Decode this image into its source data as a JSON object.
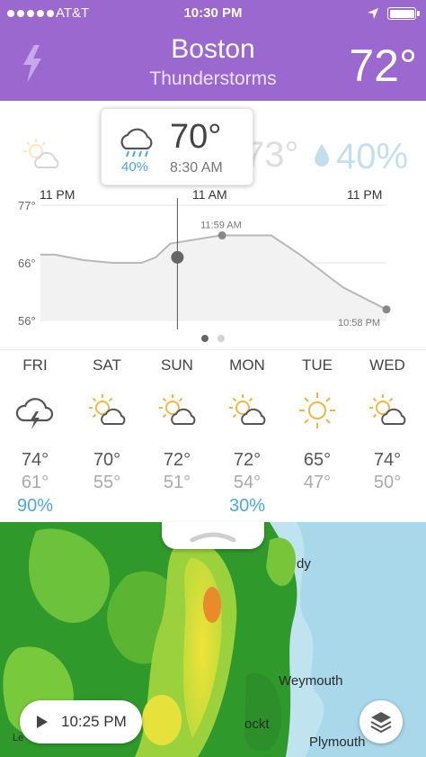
{
  "status_bar": {
    "carrier": "AT&T",
    "time": "10:30 PM"
  },
  "header": {
    "city": "Boston",
    "condition": "Thunderstorms",
    "temperature": "72°",
    "icon": "lightning-bolt-icon",
    "accent_color": "#9a68cf"
  },
  "hourly": {
    "selected": {
      "temperature": "70°",
      "time": "8:30 AM",
      "precip": "40%",
      "icon": "rain-cloud-icon"
    },
    "background_temperature": "73°",
    "background_precip": "40%",
    "time_labels": [
      "11 PM",
      "11 AM",
      "11 PM"
    ],
    "y_ticks": [
      "77°",
      "66°",
      "56°"
    ],
    "annotations": [
      "11:59 AM",
      "10:58 PM"
    ],
    "page_indicator": {
      "pages": 2,
      "current": 1
    }
  },
  "chart_data": {
    "type": "area",
    "ylim": [
      56,
      77
    ],
    "x_range": [
      0,
      24
    ],
    "x": [
      0,
      1,
      3,
      5,
      7,
      8,
      9,
      12.5,
      16,
      18,
      21,
      24
    ],
    "y": [
      68,
      68,
      67,
      66.5,
      66.5,
      67.5,
      70,
      71.5,
      71.5,
      68,
      62,
      58
    ],
    "y_ticks": [
      "77°",
      "66°",
      "56°"
    ],
    "selected_point": {
      "x": 9.5,
      "y": 67.5
    },
    "annotations": [
      {
        "label": "11:59 AM",
        "x": 12.6,
        "y": 71.5
      },
      {
        "label": "10:58 PM",
        "x": 24,
        "y": 58
      }
    ]
  },
  "daily": [
    {
      "day": "FRI",
      "high": "74°",
      "low": "61°",
      "precip": "90%",
      "icon": "thunderstorm-icon"
    },
    {
      "day": "SAT",
      "high": "70°",
      "low": "55°",
      "precip": "",
      "icon": "partly-cloudy-icon"
    },
    {
      "day": "SUN",
      "high": "72°",
      "low": "51°",
      "precip": "",
      "icon": "partly-cloudy-icon"
    },
    {
      "day": "MON",
      "high": "72°",
      "low": "54°",
      "precip": "30%",
      "icon": "partly-cloudy-icon"
    },
    {
      "day": "TUE",
      "high": "65°",
      "low": "47°",
      "precip": "",
      "icon": "sunny-icon"
    },
    {
      "day": "WED",
      "high": "74°",
      "low": "50°",
      "precip": "",
      "icon": "partly-cloudy-icon"
    }
  ],
  "map": {
    "labels": [
      "dy",
      "Weymouth",
      "Plymouth",
      "ockt",
      "Le"
    ],
    "playback_time": "10:25 PM"
  }
}
